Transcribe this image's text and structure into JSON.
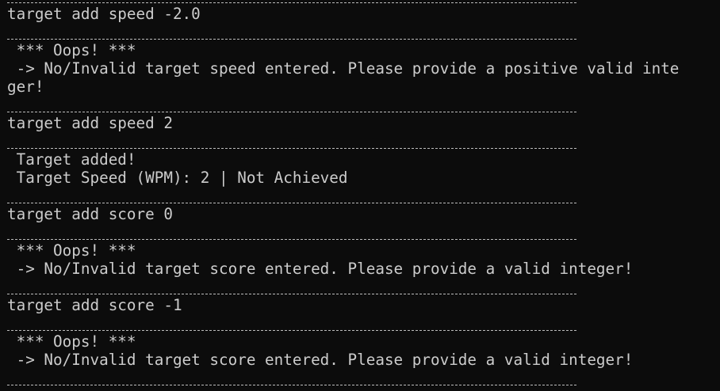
{
  "terminal": {
    "background": "#0c0c0c",
    "foreground": "#cccccc",
    "lines": {
      "cmd_speed_neg": "target add speed -2.0",
      "oops_1": " *** Oops! ***",
      "invalid_speed_1": " -> No/Invalid target speed entered. Please provide a positive valid inte",
      "invalid_speed_2": "ger!",
      "cmd_speed_2": "target add speed 2",
      "target_added": " Target added!",
      "target_speed": " Target Speed (WPM): 2 | Not Achieved",
      "cmd_score_0": "target add score 0",
      "oops_2": " *** Oops! ***",
      "invalid_score_1": " -> No/Invalid target score entered. Please provide a valid integer!",
      "cmd_score_neg": "target add score -1",
      "oops_3": " *** Oops! ***",
      "invalid_score_2": " -> No/Invalid target score entered. Please provide a valid integer!"
    }
  }
}
